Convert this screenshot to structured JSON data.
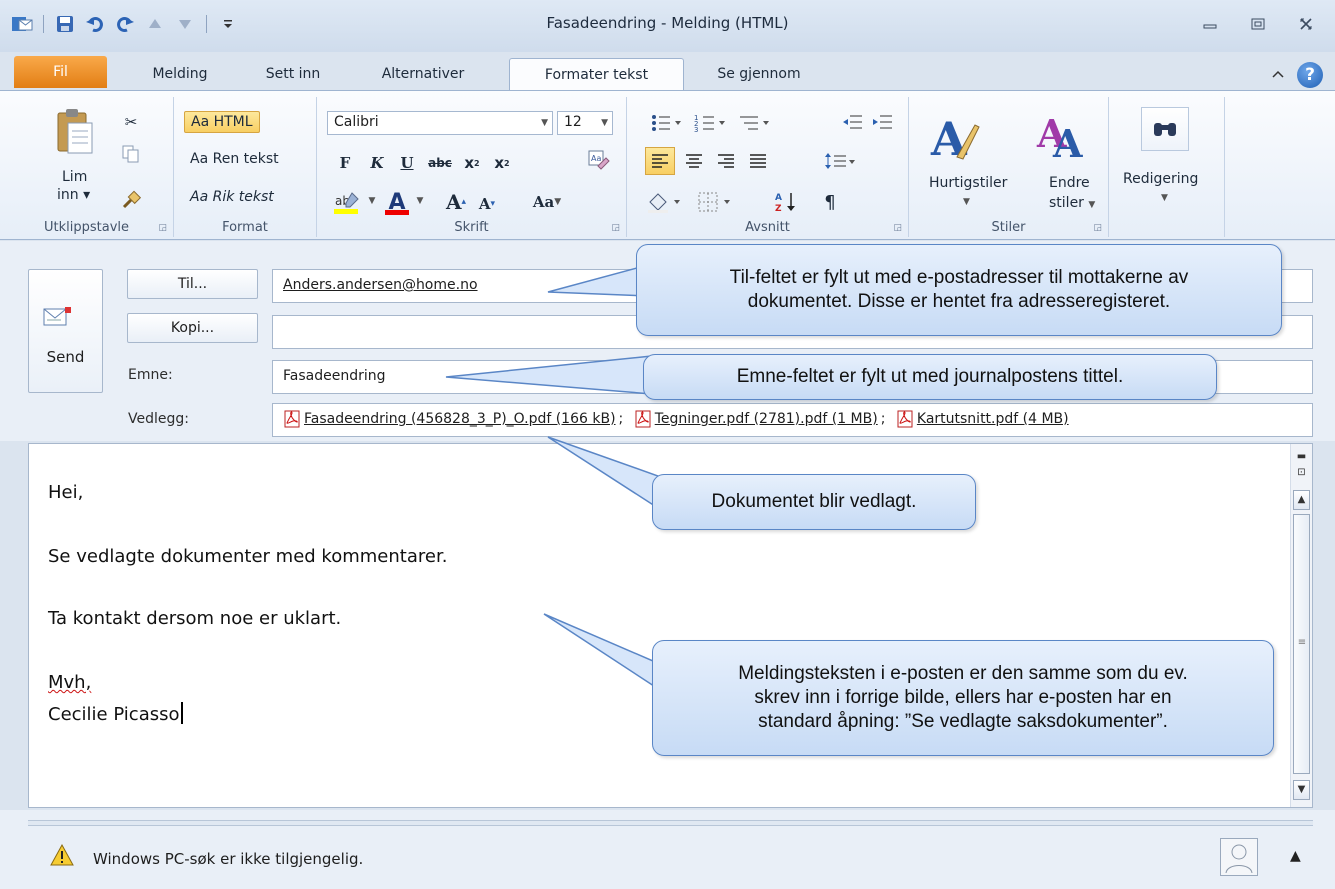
{
  "window": {
    "title": "Fasadeendring  -  Melding (HTML)"
  },
  "tabs": {
    "file": "Fil",
    "message": "Melding",
    "insert": "Sett inn",
    "options": "Alternativer",
    "format_text": "Formater tekst",
    "review": "Se gjennom"
  },
  "ribbon": {
    "clipboard": {
      "paste": "Lim",
      "paste2": "inn",
      "label": "Utklippstavle"
    },
    "format": {
      "html": "Aa HTML",
      "plain": "Aa Ren tekst",
      "rich": "Aa Rik tekst",
      "label": "Format"
    },
    "font": {
      "name": "Calibri",
      "size": "12",
      "label": "Skrift",
      "bold": "F",
      "italic": "K",
      "underline": "U",
      "strike": "abc",
      "case": "Aa"
    },
    "paragraph": {
      "label": "Avsnitt"
    },
    "styles": {
      "quick": "Hurtigstiler",
      "change1": "Endre",
      "change2": "stiler",
      "label": "Stiler"
    },
    "editing": {
      "label": "Redigering"
    }
  },
  "header": {
    "send_label": "Send",
    "to_button": "Til...",
    "cc_button": "Kopi...",
    "subject_label": "Emne:",
    "attachments_label": "Vedlegg:",
    "to_value": "Anders.andersen@home.no",
    "cc_value": "",
    "subject_value": "Fasadeendring",
    "attachments": [
      "Fasadeendring (456828_3_P)_O.pdf (166 kB)",
      "Tegninger.pdf (2781).pdf (1 MB)",
      "Kartutsnitt.pdf (4 MB)"
    ],
    "attachment_sep": ";"
  },
  "body": {
    "line1": "Hei,",
    "line2": "Se vedlagte dokumenter med kommentarer.",
    "line3": "Ta kontakt dersom noe er uklart.",
    "line4": "Mvh,",
    "line5": "Cecilie Picasso"
  },
  "status": {
    "message": "Windows PC-søk er ikke tilgjengelig."
  },
  "callouts": {
    "to": [
      "Til-feltet er fylt ut med e-postadresser til mottakerne av",
      "dokumentet. Disse er hentet fra adresseregisteret."
    ],
    "subject": "Emne-feltet er fylt ut med journalpostens tittel.",
    "attachment": "Dokumentet blir vedlagt.",
    "body": [
      "Meldingsteksten i e-posten er den samme som du ev.",
      "skrev inn i forrige bilde, ellers har e-posten har en",
      "standard  åpning: ”Se vedlagte saksdokumenter”."
    ]
  },
  "colors": {
    "file_tab": "#e27e14",
    "callout_border": "#5a86c6",
    "callout_fill": "#c7dbf5",
    "highlight": "#f8cf63"
  }
}
